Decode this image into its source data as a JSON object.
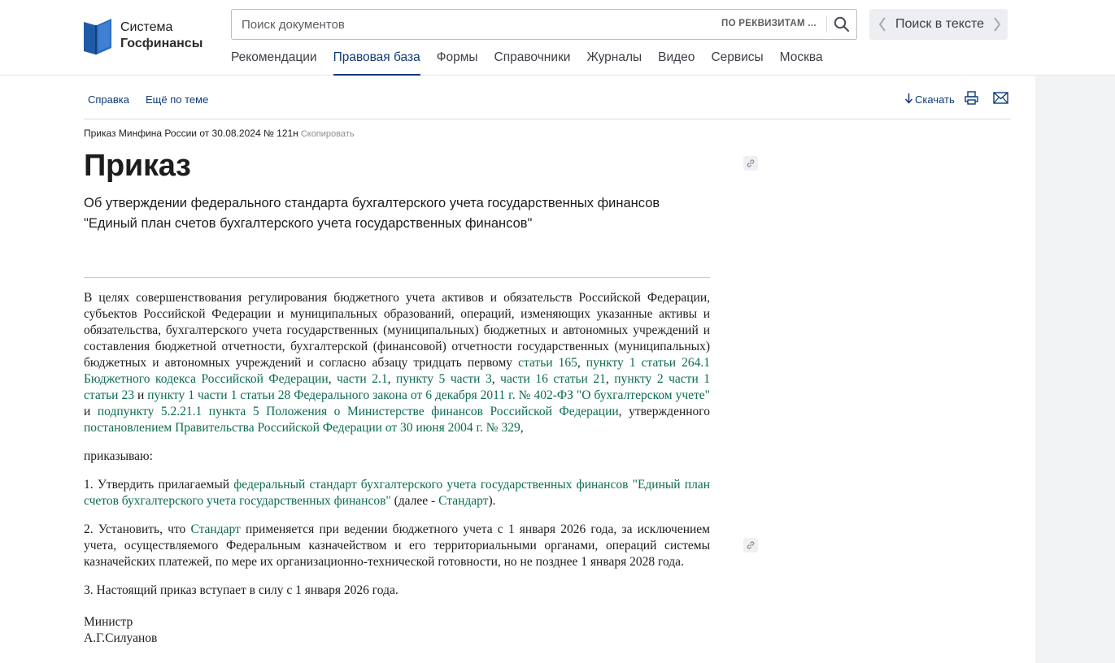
{
  "header": {
    "logo": {
      "line1": "Система",
      "line2": "Госфинансы"
    },
    "search": {
      "placeholder": "Поиск документов",
      "requisites_label": "ПО РЕКВИЗИТАМ ..."
    },
    "text_search": {
      "label": "Поиск в тексте"
    },
    "nav": [
      {
        "label": "Рекомендации"
      },
      {
        "label": "Правовая база",
        "active": true
      },
      {
        "label": "Формы"
      },
      {
        "label": "Справочники"
      },
      {
        "label": "Журналы"
      },
      {
        "label": "Видео"
      },
      {
        "label": "Сервисы"
      },
      {
        "label": "Москва"
      }
    ]
  },
  "toolbar": {
    "help": "Справка",
    "more": "Ещё по теме",
    "download": "Скачать"
  },
  "document": {
    "reference": "Приказ Минфина России от 30.08.2024 № 121н",
    "copy_label": "Скопировать",
    "title": "Приказ",
    "subtitle_line1": "Об утверждении федерального стандарта бухгалтерского учета государственных финансов",
    "subtitle_line2": "\"Единый план счетов бухгалтерского учета государственных финансов\"",
    "p1": {
      "t1": "В целях совершенствования регулирования бюджетного учета активов и обязательств Российской Федерации, субъектов Российской Федерации и муниципальных образований, операций, изменяющих указанные активы и обязательства, бухгалтерского учета государственных (муниципальных) бюджетных и автономных учреждений и составления бюджетной отчетности, бухгалтерской (финансовой) отчетности государственных (муниципальных) бюджетных и автономных учреждений и согласно абзацу тридцать первому ",
      "l1": "статьи 165",
      "s1": ", ",
      "l2": "пункту 1 статьи 264.1 Бюджетного кодекса Российской Федерации",
      "s2": ", ",
      "l3": "части 2.1",
      "s3": ", ",
      "l4": "пункту 5 части 3",
      "s4": ", ",
      "l5": "части 16 статьи 21",
      "s5": ", ",
      "l6": "пункту 2 части 1 статьи 23",
      "s6": " и ",
      "l7": "пункту 1 части 1 статьи 28 Федерального закона от 6 декабря 2011 г. № 402-ФЗ \"О бухгалтерском учете\"",
      "s7": " и ",
      "l8": "подпункту 5.2.21.1 пункта 5 Положения о Министерстве финансов Российской Федерации",
      "s8": ", утвержденного ",
      "l9": "постановлением Правительства Российской Федерации от 30 июня 2004 г. № 329",
      "s9": ","
    },
    "p2": "приказываю:",
    "p3": {
      "t1": "1. Утвердить прилагаемый ",
      "l1": "федеральный стандарт бухгалтерского учета государственных финансов \"Единый план счетов бухгалтерского учета государственных финансов\"",
      "t2": " (далее - ",
      "l2": "Стандарт",
      "t3": ")."
    },
    "p4": {
      "t1": "2. Установить, что ",
      "l1": "Стандарт",
      "t2": " применяется при ведении бюджетного учета с 1 января 2026 года, за исключением учета, осуществляемого Федеральным казначейством и его территориальными органами, операций системы казначейских платежей, по мере их организационно-технической готовности, но не позднее 1 января 2028 года."
    },
    "p5": "3. Настоящий приказ вступает в силу с 1 января 2026 года.",
    "signature_role": "Министр",
    "signature_name": "А.Г.Силуанов"
  },
  "colors": {
    "brand": "#0d3b78",
    "link": "#0b6b52",
    "logo": "#1f5aa6"
  }
}
